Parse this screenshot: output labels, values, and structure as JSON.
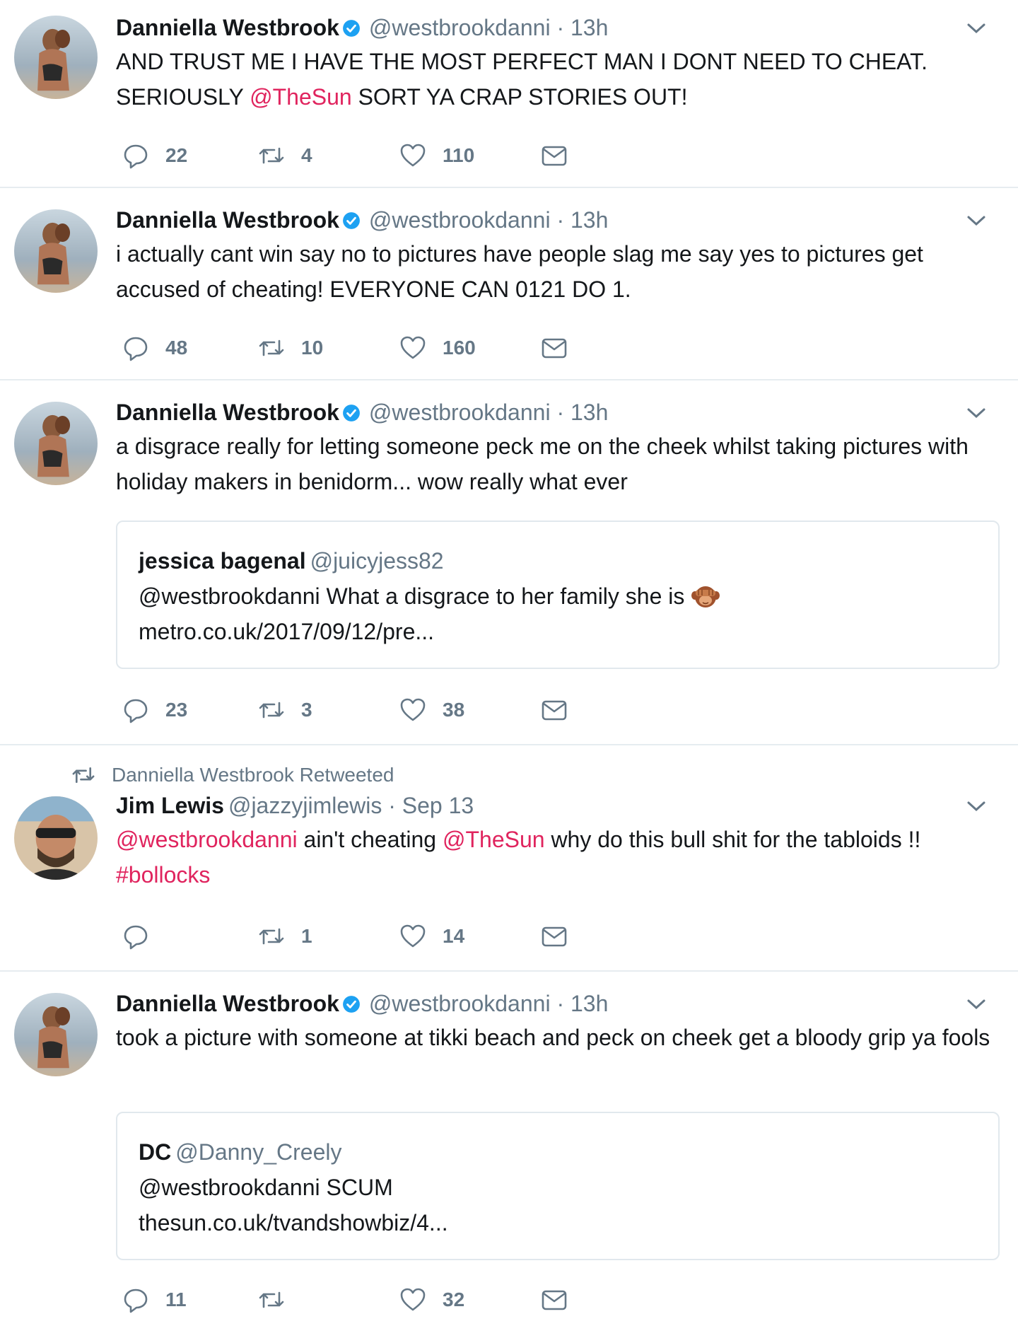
{
  "colors": {
    "accent_link": "#e0245e",
    "secondary_text": "#657786",
    "verified_blue": "#1da1f2",
    "divider": "#e6ecf0"
  },
  "tweets": [
    {
      "author_name": "Danniella Westbrook",
      "handle": "@westbrookdanni",
      "dot": "·",
      "time": "13h",
      "verified": true,
      "text_parts": [
        {
          "t": "AND TRUST ME I HAVE THE MOST PERFECT MAN I DONT NEED TO CHEAT. SERIOUSLY ",
          "link": false
        },
        {
          "t": "@TheSun",
          "link": true
        },
        {
          "t": " SORT YA CRAP STORIES OUT!",
          "link": false
        }
      ],
      "replies": "22",
      "retweets": "4",
      "likes": "110"
    },
    {
      "author_name": "Danniella Westbrook",
      "handle": "@westbrookdanni",
      "dot": "·",
      "time": "13h",
      "verified": true,
      "text_parts": [
        {
          "t": "i actually cant win  say no to pictures have people slag me say yes to pictures get accused of cheating! EVERYONE CAN 0121 DO 1.",
          "link": false
        }
      ],
      "replies": "48",
      "retweets": "10",
      "likes": "160"
    },
    {
      "author_name": "Danniella Westbrook",
      "handle": "@westbrookdanni",
      "dot": "·",
      "time": "13h",
      "verified": true,
      "text_parts": [
        {
          "t": "a disgrace really for letting someone peck me on the cheek whilst taking pictures with holiday makers in benidorm... wow really what ever",
          "link": false
        }
      ],
      "quote": {
        "name": "jessica bagenal",
        "handle": "@juicyjess82",
        "text": "@westbrookdanni What a disgrace to her family she is",
        "emoji": "see-no-evil-monkey-emoji",
        "link": "metro.co.uk/2017/09/12/pre..."
      },
      "replies": "23",
      "retweets": "3",
      "likes": "38"
    },
    {
      "retweeted_by": "Danniella Westbrook Retweeted",
      "author_name": "Jim Lewis",
      "handle": "@jazzyjimlewis",
      "dot": "·",
      "time": "Sep 13",
      "verified": false,
      "text_parts": [
        {
          "t": "@westbrookdanni",
          "link": true
        },
        {
          "t": " ain't cheating ",
          "link": false
        },
        {
          "t": "@TheSun",
          "link": true
        },
        {
          "t": " why do this bull shit for the tabloids !! ",
          "link": false
        },
        {
          "t": "#bollocks",
          "link": true
        }
      ],
      "replies": "",
      "retweets": "1",
      "likes": "14"
    },
    {
      "author_name": "Danniella Westbrook",
      "handle": "@westbrookdanni",
      "dot": "·",
      "time": "13h",
      "verified": true,
      "text_parts": [
        {
          "t": "took a picture with someone at tikki beach and peck on cheek get a bloody grip ya fools",
          "link": false
        }
      ],
      "quote": {
        "name": "DC",
        "handle": "@Danny_Creely",
        "text": "@westbrookdanni SCUM",
        "link": "thesun.co.uk/tvandshowbiz/4..."
      },
      "replies": "11",
      "retweets": "",
      "likes": "32"
    }
  ]
}
